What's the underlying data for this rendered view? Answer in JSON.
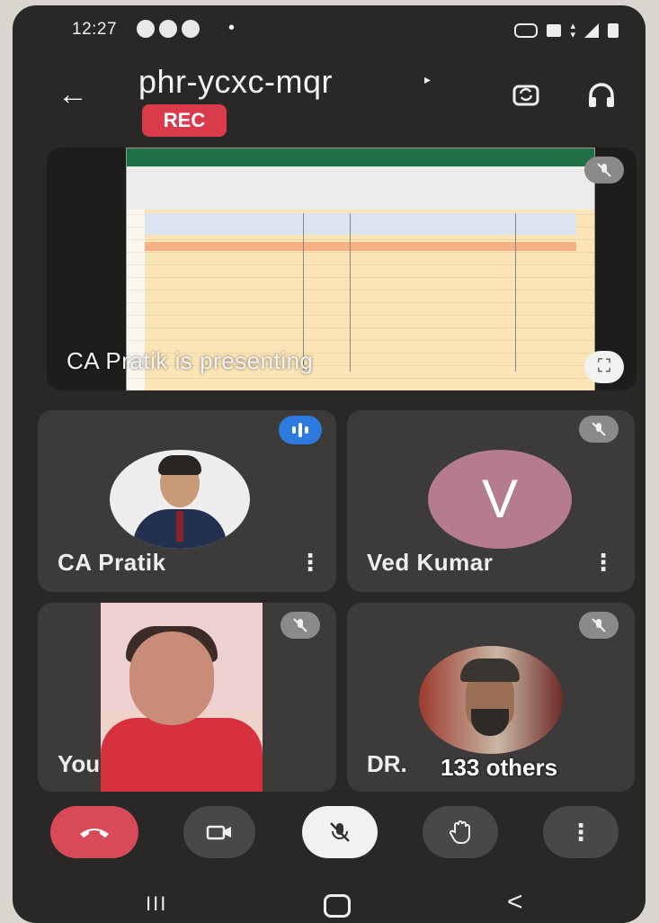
{
  "status_bar": {
    "time": "12:27",
    "dot": "•"
  },
  "header": {
    "meeting_code": "phr-ycxc-mqr",
    "caret": "▸",
    "rec_badge": "REC",
    "back_icon": "←"
  },
  "tiles": {
    "presentation": {
      "caption": "CA Pratik is presenting",
      "fullscreen_icon": "⛶"
    },
    "pratik": {
      "name": "CA Pratik",
      "menu": "⋮"
    },
    "ved": {
      "name": "Ved Kumar",
      "initial": "V",
      "menu": "⋮"
    },
    "you": {
      "name": "You"
    },
    "others": {
      "name": "DR.",
      "count_label": "133 others"
    }
  },
  "controls": {
    "more_icon": "⋮"
  },
  "navbar": {
    "recent": "III",
    "back": "<"
  },
  "colors": {
    "rec": "#d93b4a",
    "hangup": "#d94a59",
    "speaking": "#2e7be0",
    "avatar_v": "#b47c8d"
  }
}
